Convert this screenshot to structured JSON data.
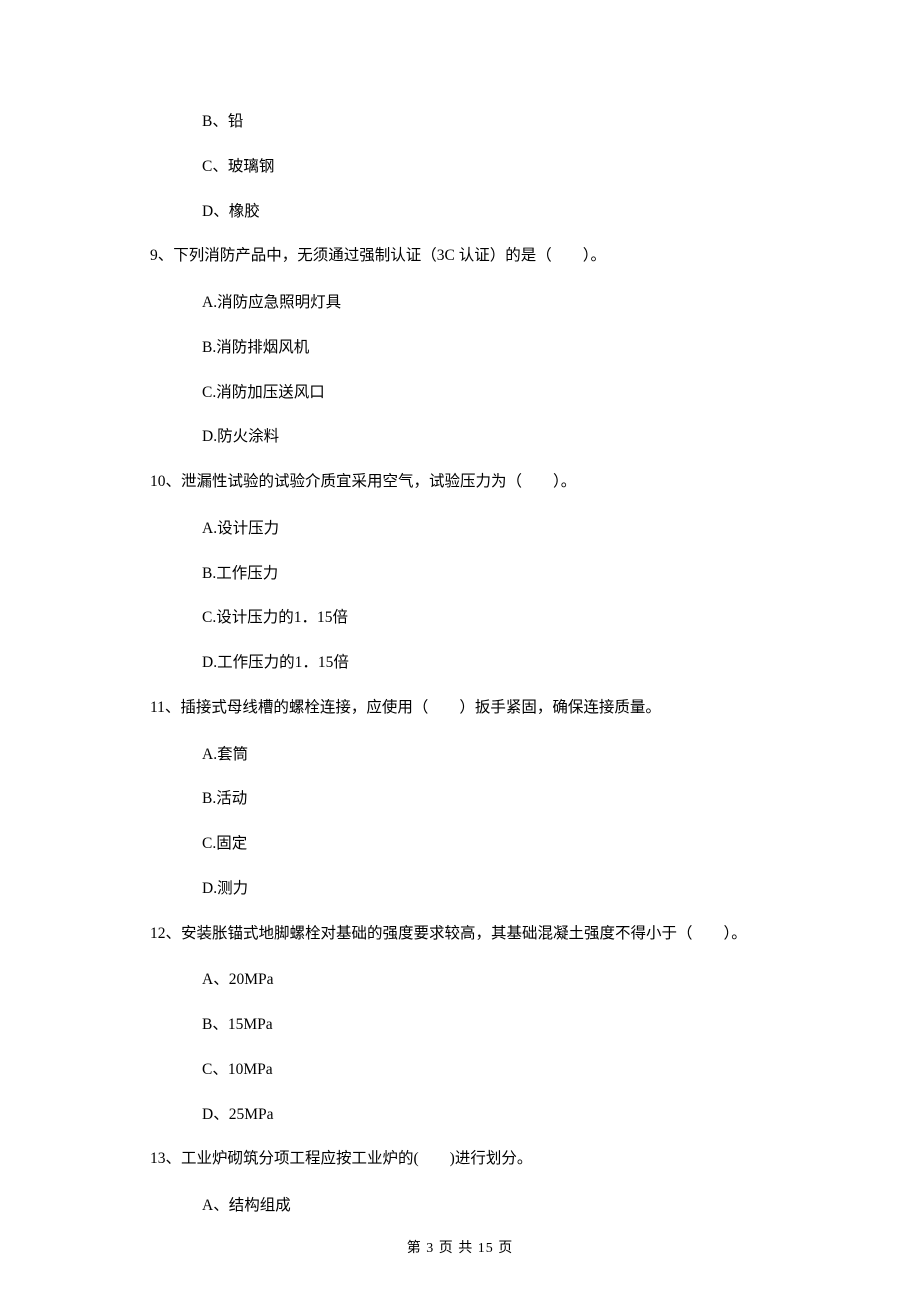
{
  "opt_prev_B": "B、铅",
  "opt_prev_C": "C、玻璃钢",
  "opt_prev_D": "D、橡胶",
  "q9": {
    "text": "9、下列消防产品中，无须通过强制认证（3C 认证）的是（　　）。",
    "A": "A.消防应急照明灯具",
    "B": "B.消防排烟风机",
    "C": "C.消防加压送风口",
    "D": "D.防火涂料"
  },
  "q10": {
    "text": "10、泄漏性试验的试验介质宜采用空气，试验压力为（　　）。",
    "A": "A.设计压力",
    "B": "B.工作压力",
    "C": "C.设计压力的1．15倍",
    "D": "D.工作压力的1．15倍"
  },
  "q11": {
    "text": "11、插接式母线槽的螺栓连接，应使用（　　）扳手紧固，确保连接质量。",
    "A": "A.套筒",
    "B": "B.活动",
    "C": "C.固定",
    "D": "D.测力"
  },
  "q12": {
    "text": "12、安装胀锚式地脚螺栓对基础的强度要求较高，其基础混凝土强度不得小于（　　）。",
    "A": "A、20MPa",
    "B": "B、15MPa",
    "C": "C、10MPa",
    "D": "D、25MPa"
  },
  "q13": {
    "text": "13、工业炉砌筑分项工程应按工业炉的(　　)进行划分。",
    "A": "A、结构组成"
  },
  "footer": "第 3 页 共 15 页"
}
